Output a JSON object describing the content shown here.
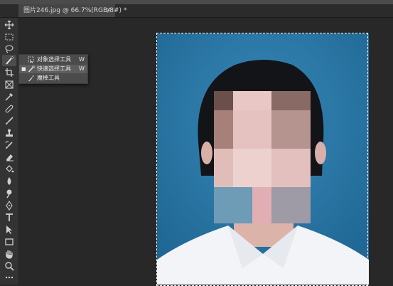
{
  "document": {
    "tab_title": "图片246.jpg @ 66.7%(RGB/8#) *",
    "close_glyph": "×"
  },
  "toolbar": {
    "tools": [
      {
        "name": "move-icon"
      },
      {
        "name": "marquee-icon"
      },
      {
        "name": "lasso-icon"
      },
      {
        "name": "quick-selection-icon",
        "active": true
      },
      {
        "name": "crop-icon"
      },
      {
        "name": "frame-icon"
      },
      {
        "name": "eyedropper-icon"
      },
      {
        "name": "healing-brush-icon"
      },
      {
        "name": "brush-icon"
      },
      {
        "name": "clone-stamp-icon"
      },
      {
        "name": "history-brush-icon"
      },
      {
        "name": "eraser-icon"
      },
      {
        "name": "paint-bucket-icon"
      },
      {
        "name": "blur-icon"
      },
      {
        "name": "dodge-icon"
      },
      {
        "name": "pen-icon"
      },
      {
        "name": "type-icon"
      },
      {
        "name": "path-selection-icon"
      },
      {
        "name": "rectangle-icon"
      },
      {
        "name": "hand-icon"
      },
      {
        "name": "zoom-icon"
      },
      {
        "name": "more-icon"
      }
    ]
  },
  "flyout": {
    "items": [
      {
        "label": "对象选择工具",
        "shortcut": "W",
        "selected": false
      },
      {
        "label": "快速选择工具",
        "shortcut": "W",
        "selected": true
      },
      {
        "label": "魔棒工具",
        "shortcut": "",
        "selected": false
      }
    ],
    "bullet": "■"
  },
  "colors": {
    "background": "#2f79a6",
    "hair": "#121418",
    "skin": "#e2c2bd",
    "shirt": "#f2f4f7"
  }
}
